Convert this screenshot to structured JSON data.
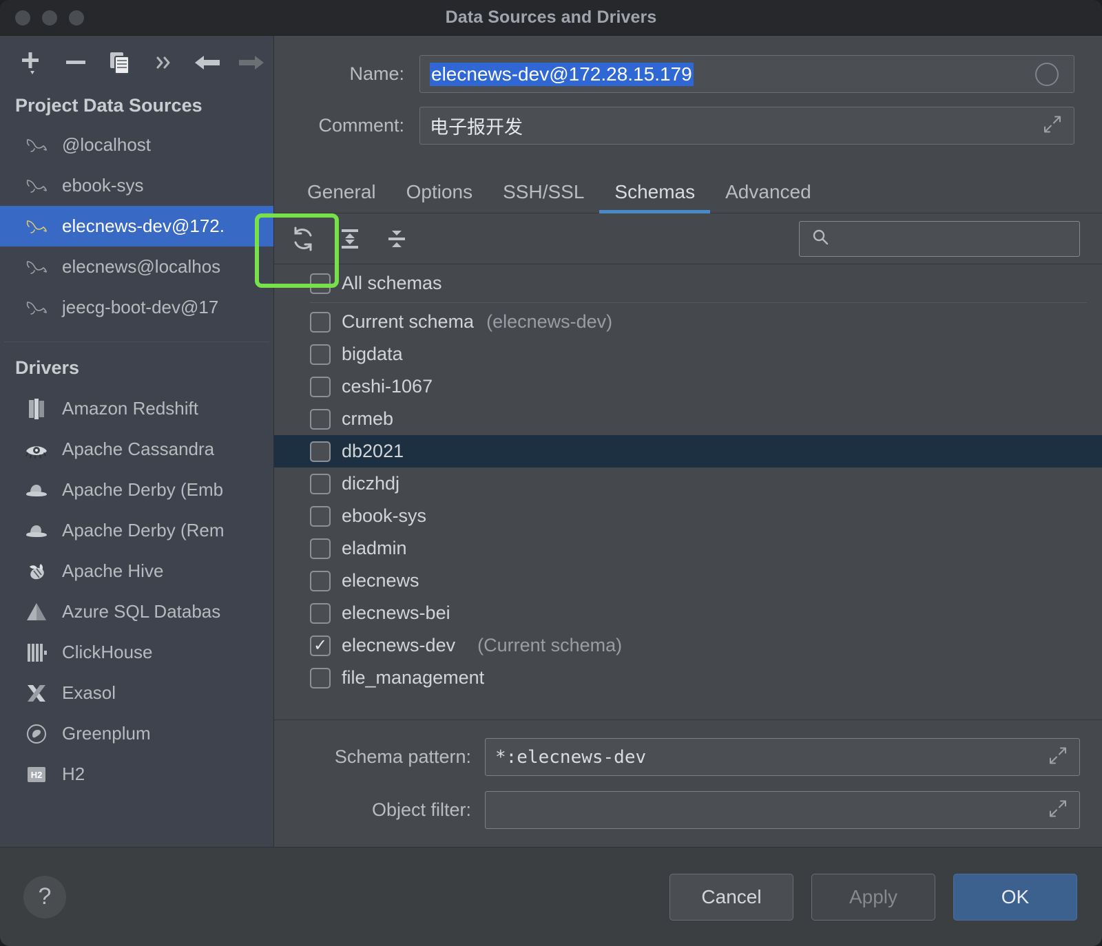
{
  "window": {
    "title": "Data Sources and Drivers",
    "traffic_lights": [
      "close-button",
      "minimize-button",
      "zoom-button"
    ]
  },
  "sidebar": {
    "toolbar": [
      {
        "name": "add-data-source-button",
        "icon": "plus-dropdown-icon",
        "dim": false
      },
      {
        "name": "remove-data-source-button",
        "icon": "minus-icon",
        "dim": false
      },
      {
        "name": "duplicate-data-source-button",
        "icon": "copy-icon",
        "dim": false
      },
      {
        "name": "more-options-button",
        "icon": "chevron-double-right-icon",
        "dim": false
      },
      {
        "name": "navigate-back-button",
        "icon": "arrow-left-icon",
        "dim": false
      },
      {
        "name": "navigate-forward-button",
        "icon": "arrow-right-icon",
        "dim": true
      }
    ],
    "data_sources_title": "Project Data Sources",
    "data_sources": [
      {
        "label": "@localhost",
        "icon": "mysql-dolphin-icon",
        "selected": false
      },
      {
        "label": "ebook-sys",
        "icon": "mysql-dolphin-icon",
        "selected": false
      },
      {
        "label": "elecnews-dev@172.",
        "icon": "mysql-dolphin-icon",
        "selected": true
      },
      {
        "label": "elecnews@localhos",
        "icon": "mysql-dolphin-icon",
        "selected": false
      },
      {
        "label": "jeecg-boot-dev@17",
        "icon": "mysql-dolphin-icon",
        "selected": false
      }
    ],
    "drivers_title": "Drivers",
    "drivers": [
      {
        "label": "Amazon Redshift",
        "icon": "amazon-redshift-icon"
      },
      {
        "label": "Apache Cassandra",
        "icon": "cassandra-eye-icon"
      },
      {
        "label": "Apache Derby (Emb",
        "icon": "derby-hat-icon"
      },
      {
        "label": "Apache Derby (Rem",
        "icon": "derby-hat-icon"
      },
      {
        "label": "Apache Hive",
        "icon": "hive-bee-icon"
      },
      {
        "label": "Azure SQL Databas",
        "icon": "azure-triangle-icon"
      },
      {
        "label": "ClickHouse",
        "icon": "clickhouse-bars-icon"
      },
      {
        "label": "Exasol",
        "icon": "exasol-x-icon"
      },
      {
        "label": "Greenplum",
        "icon": "greenplum-circle-icon"
      },
      {
        "label": "H2",
        "icon": "h2-badge-icon"
      }
    ]
  },
  "main": {
    "name_label": "Name:",
    "name_value": "elecnews-dev@172.28.15.179",
    "comment_label": "Comment:",
    "comment_value": "电子报开发",
    "tabs": [
      {
        "label": "General",
        "active": false
      },
      {
        "label": "Options",
        "active": false
      },
      {
        "label": "SSH/SSL",
        "active": false
      },
      {
        "label": "Schemas",
        "active": true
      },
      {
        "label": "Advanced",
        "active": false
      }
    ],
    "schemas_toolbar": [
      {
        "name": "refresh-schemas-button",
        "icon": "refresh-icon"
      },
      {
        "name": "expand-all-button",
        "icon": "expand-all-icon"
      },
      {
        "name": "collapse-all-button",
        "icon": "collapse-all-icon"
      }
    ],
    "search": {
      "value": "",
      "placeholder": "",
      "icon": "search-icon"
    },
    "schema_rows": [
      {
        "label": "All schemas",
        "sub": "",
        "checked": false,
        "highlight": false,
        "separator_after": true
      },
      {
        "label": "Current schema",
        "sub": "(elecnews-dev)",
        "checked": false,
        "highlight": false
      },
      {
        "label": "bigdata",
        "sub": "",
        "checked": false,
        "highlight": false
      },
      {
        "label": "ceshi-1067",
        "sub": "",
        "checked": false,
        "highlight": false
      },
      {
        "label": "crmeb",
        "sub": "",
        "checked": false,
        "highlight": false
      },
      {
        "label": "db2021",
        "sub": "",
        "checked": false,
        "highlight": true
      },
      {
        "label": "diczhdj",
        "sub": "",
        "checked": false,
        "highlight": false
      },
      {
        "label": "ebook-sys",
        "sub": "",
        "checked": false,
        "highlight": false
      },
      {
        "label": "eladmin",
        "sub": "",
        "checked": false,
        "highlight": false
      },
      {
        "label": "elecnews",
        "sub": "",
        "checked": false,
        "highlight": false
      },
      {
        "label": "elecnews-bei",
        "sub": "",
        "checked": false,
        "highlight": false
      },
      {
        "label": "elecnews-dev",
        "sub": "(Current schema)",
        "checked": true,
        "highlight": false,
        "sub_wide": true
      },
      {
        "label": "file_management",
        "sub": "",
        "checked": false,
        "highlight": false
      }
    ],
    "schema_pattern_label": "Schema pattern:",
    "schema_pattern_value": "*:elecnews-dev",
    "object_filter_label": "Object filter:",
    "object_filter_value": ""
  },
  "footer": {
    "help_label": "?",
    "cancel_label": "Cancel",
    "apply_label": "Apply",
    "ok_label": "OK"
  },
  "annotation": {
    "name": "refresh-button-highlight",
    "color": "#78e04a"
  }
}
